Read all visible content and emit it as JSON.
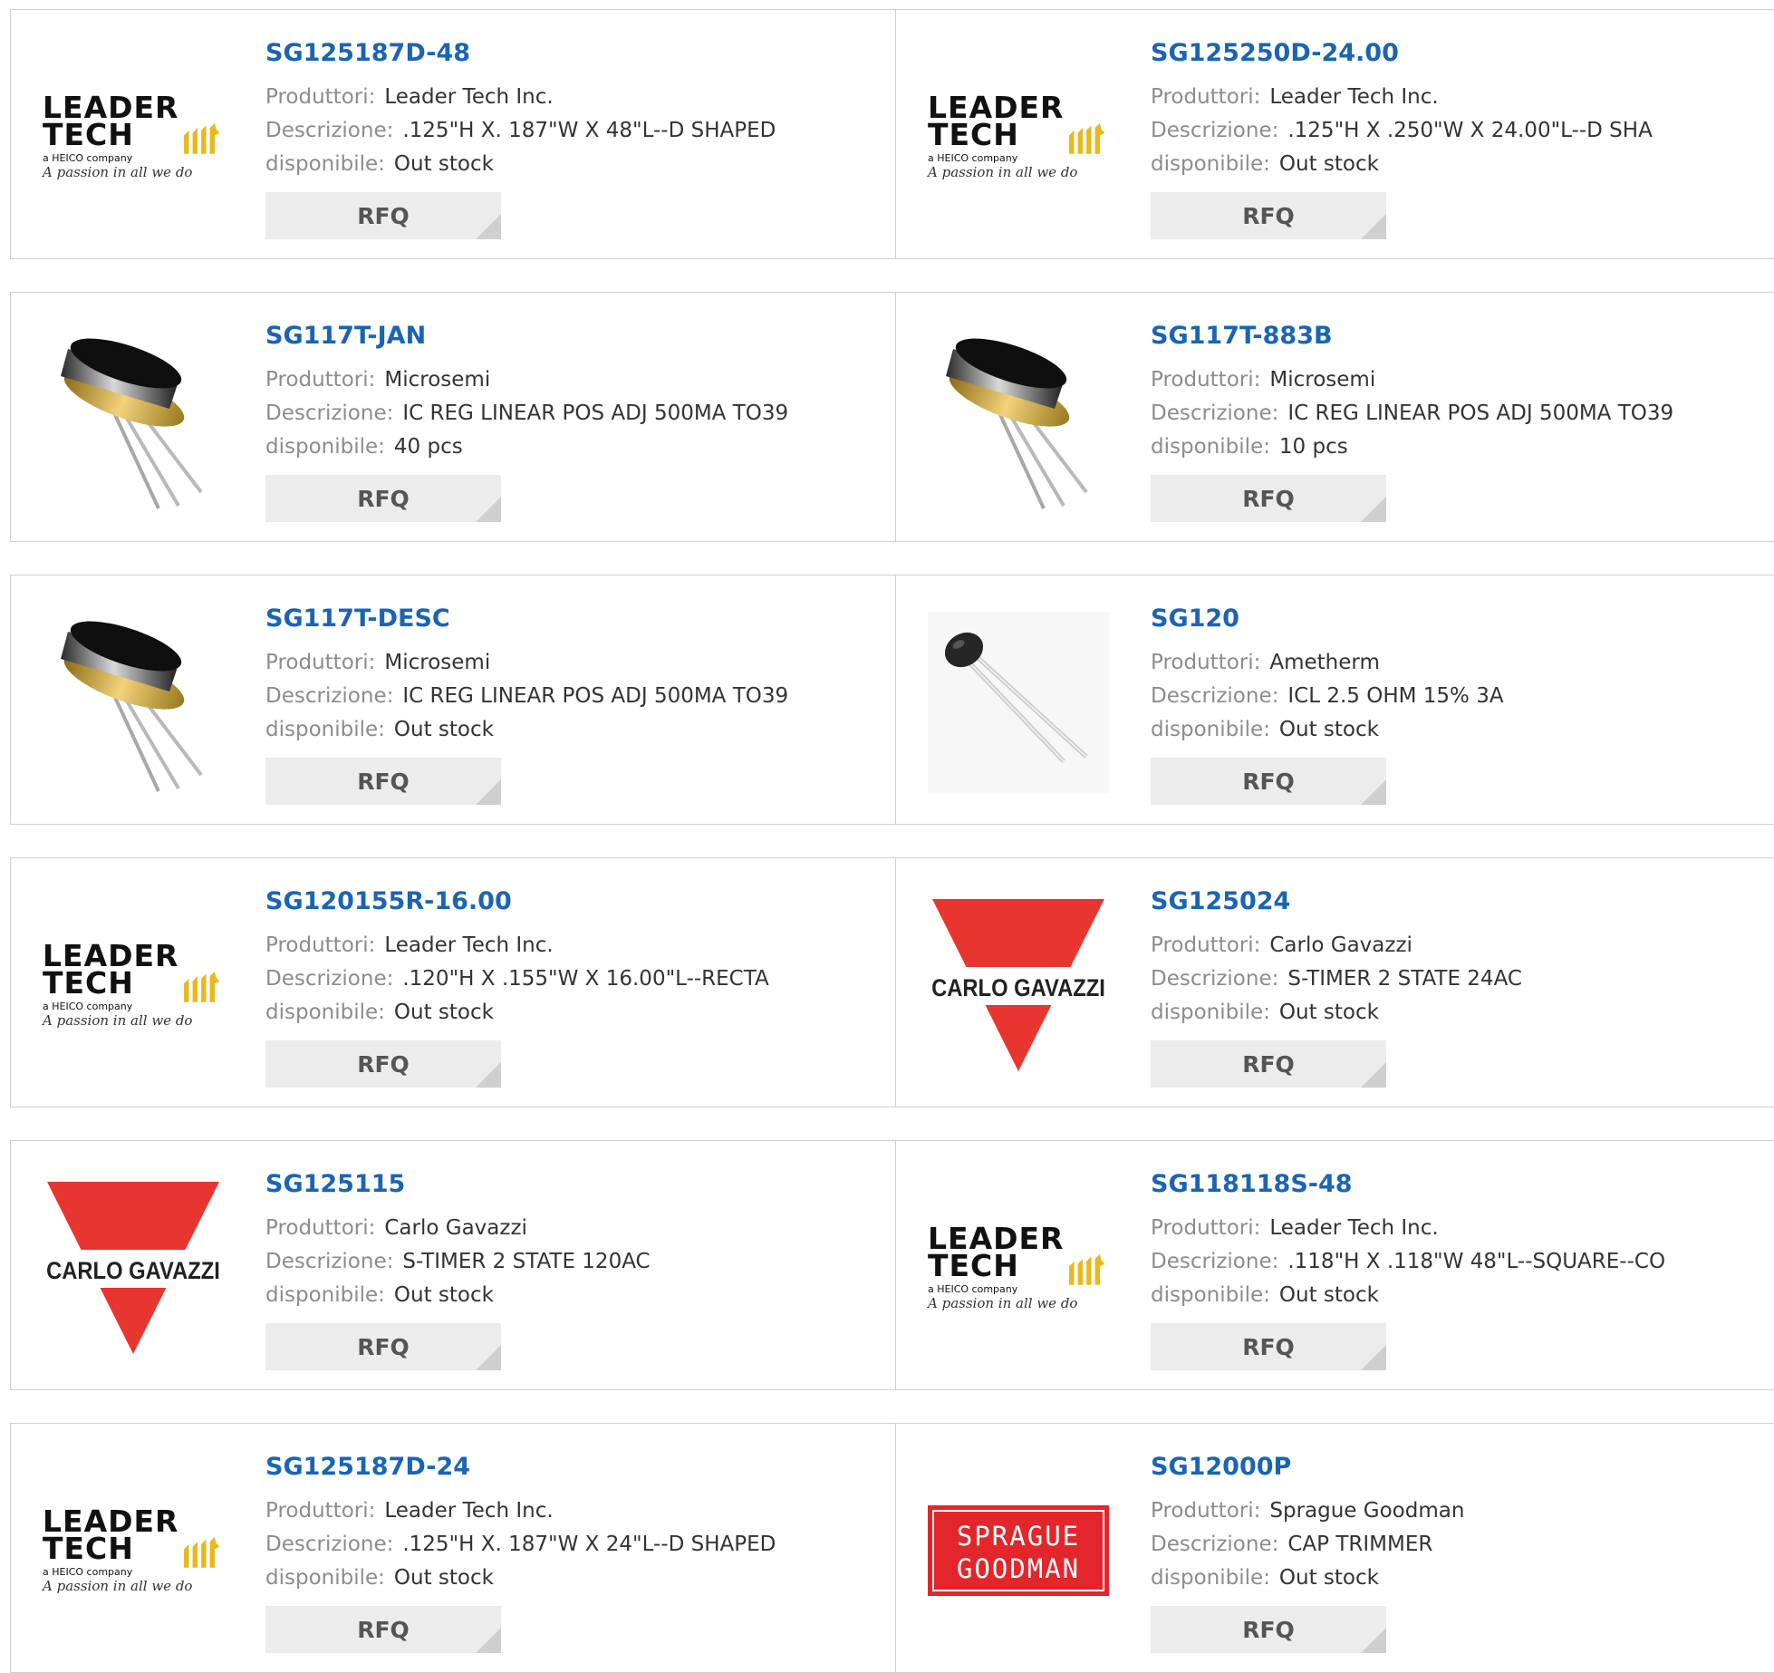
{
  "labels": {
    "manufacturer": "Produttori:",
    "description": "Descrizione:",
    "availability": "disponibile:",
    "rfq": "RFQ"
  },
  "logo_text": {
    "leader_tech": {
      "line1": "LEADER",
      "line2": "TECH",
      "tagline": "a HEICO company",
      "script": "A passion in all we do"
    },
    "carlo_gavazzi": "CARLO GAVAZZI",
    "sprague_line1": "SPRAGUE",
    "sprague_line2": "GOODMAN"
  },
  "colors": {
    "link_blue": "#1a64b4",
    "label_gray": "#8c8c8c",
    "button_bg": "#ececec",
    "carlo_red": "#e8352f",
    "sprague_red": "#e3262b",
    "lt_yellow": "#e9b81c"
  },
  "products": [
    {
      "part": "SG125187D-48",
      "manufacturer": "Leader Tech Inc.",
      "description": ".125\"H X. 187\"W X 48\"L--D SHAPED",
      "availability": "Out stock",
      "image": "leader-tech-logo"
    },
    {
      "part": "SG125250D-24.00",
      "manufacturer": "Leader Tech Inc.",
      "description": ".125\"H X .250\"W X 24.00\"L--D SHA",
      "availability": "Out stock",
      "image": "leader-tech-logo"
    },
    {
      "part": "SG117T-JAN",
      "manufacturer": "Microsemi",
      "description": "IC REG LINEAR POS ADJ 500MA TO39",
      "availability": "40 pcs",
      "image": "to39-package-image"
    },
    {
      "part": "SG117T-883B",
      "manufacturer": "Microsemi",
      "description": "IC REG LINEAR POS ADJ 500MA TO39",
      "availability": "10 pcs",
      "image": "to39-package-image"
    },
    {
      "part": "SG117T-DESC",
      "manufacturer": "Microsemi",
      "description": "IC REG LINEAR POS ADJ 500MA TO39",
      "availability": "Out stock",
      "image": "to39-package-image"
    },
    {
      "part": "SG120",
      "manufacturer": "Ametherm",
      "description": "ICL 2.5 OHM 15% 3A",
      "availability": "Out stock",
      "image": "thermistor-image"
    },
    {
      "part": "SG120155R-16.00",
      "manufacturer": "Leader Tech Inc.",
      "description": ".120\"H X .155\"W X 16.00\"L--RECTA",
      "availability": "Out stock",
      "image": "leader-tech-logo"
    },
    {
      "part": "SG125024",
      "manufacturer": "Carlo Gavazzi",
      "description": "S-TIMER 2 STATE 24AC",
      "availability": "Out stock",
      "image": "carlo-gavazzi-logo"
    },
    {
      "part": "SG125115",
      "manufacturer": "Carlo Gavazzi",
      "description": "S-TIMER 2 STATE 120AC",
      "availability": "Out stock",
      "image": "carlo-gavazzi-logo"
    },
    {
      "part": "SG118118S-48",
      "manufacturer": "Leader Tech Inc.",
      "description": ".118\"H X .118\"W 48\"L--SQUARE--CO",
      "availability": "Out stock",
      "image": "leader-tech-logo"
    },
    {
      "part": "SG125187D-24",
      "manufacturer": "Leader Tech Inc.",
      "description": ".125\"H X. 187\"W X 24\"L--D SHAPED",
      "availability": "Out stock",
      "image": "leader-tech-logo"
    },
    {
      "part": "SG12000P",
      "manufacturer": "Sprague Goodman",
      "description": "CAP TRIMMER",
      "availability": "Out stock",
      "image": "sprague-goodman-logo"
    }
  ]
}
